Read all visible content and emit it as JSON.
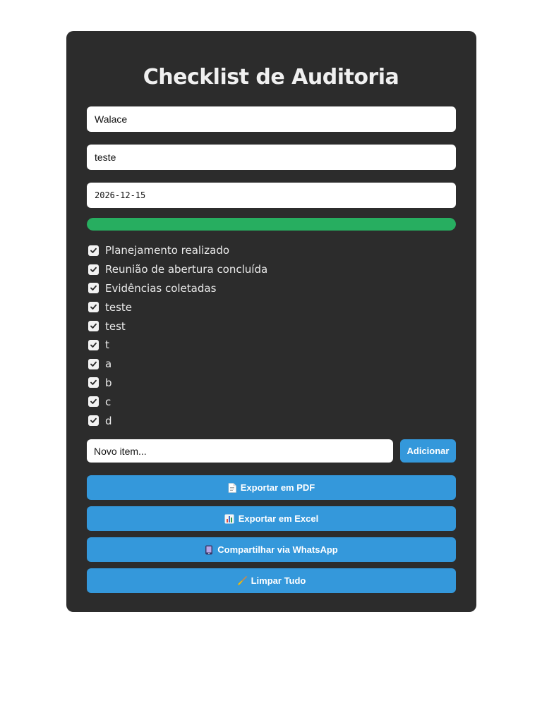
{
  "title": "Checklist de Auditoria",
  "fields": {
    "name": "Walace",
    "description": "teste",
    "date": "2026-12-15"
  },
  "progress": 1.0,
  "colors": {
    "card_bg": "#2c2c2c",
    "progress": "#27ae60",
    "button": "#3498db"
  },
  "checklist": {
    "items": [
      {
        "label": "Planejamento realizado",
        "checked": true
      },
      {
        "label": "Reunião de abertura concluída",
        "checked": true
      },
      {
        "label": "Evidências coletadas",
        "checked": true
      },
      {
        "label": "teste",
        "checked": true
      },
      {
        "label": "test",
        "checked": true
      },
      {
        "label": "t",
        "checked": true
      },
      {
        "label": "a",
        "checked": true
      },
      {
        "label": "b",
        "checked": true
      },
      {
        "label": "c",
        "checked": true
      },
      {
        "label": "d",
        "checked": true
      }
    ]
  },
  "new_item": {
    "placeholder": "Novo item...",
    "add_label": "Adicionar"
  },
  "actions": {
    "pdf": {
      "label": "Exportar em PDF",
      "icon": "document-icon"
    },
    "excel": {
      "label": "Exportar em Excel",
      "icon": "bar-chart-icon"
    },
    "whatsapp": {
      "label": "Compartilhar via WhatsApp",
      "icon": "phone-icon"
    },
    "clear": {
      "label": "Limpar Tudo",
      "icon": "broom-icon"
    }
  }
}
